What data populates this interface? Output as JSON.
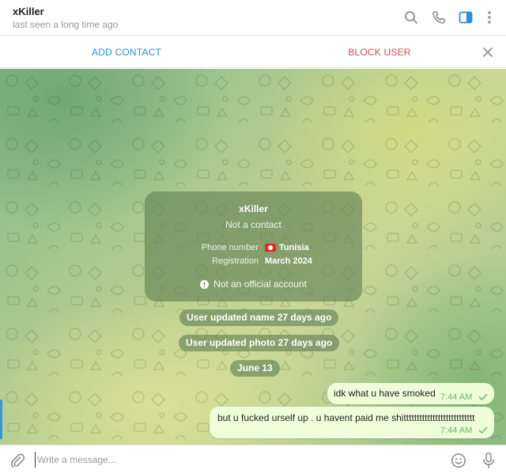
{
  "header": {
    "name": "xKiller",
    "status": "last seen a long time ago",
    "icons": [
      "search-icon",
      "phone-icon",
      "sidebar-toggle-icon",
      "more-vertical-icon"
    ]
  },
  "actionbar": {
    "add_contact": "ADD CONTACT",
    "block_user": "BLOCK USER"
  },
  "info_card": {
    "name": "xKiller",
    "subtitle": "Not a contact",
    "phone_label": "Phone number",
    "phone_value": "Tunisia",
    "registration_label": "Registration",
    "registration_value": "March 2024",
    "official_note": "Not an official account"
  },
  "service": {
    "name_update": "User updated name 27 days ago",
    "photo_update": "User updated photo 27 days ago",
    "date": "June 13"
  },
  "messages": [
    {
      "text": "idk what u have smoked",
      "time": "7:44 AM"
    },
    {
      "text": "but u fucked urself up . u havent paid me shittttttttttttttttttttttttttt",
      "time": "7:44 AM"
    }
  ],
  "composer": {
    "placeholder": "Write a message..."
  },
  "colors": {
    "accent": "#2a8fd6",
    "danger": "#d14b4b",
    "bubble": "#eefed9",
    "read_check": "#6bb36a"
  }
}
